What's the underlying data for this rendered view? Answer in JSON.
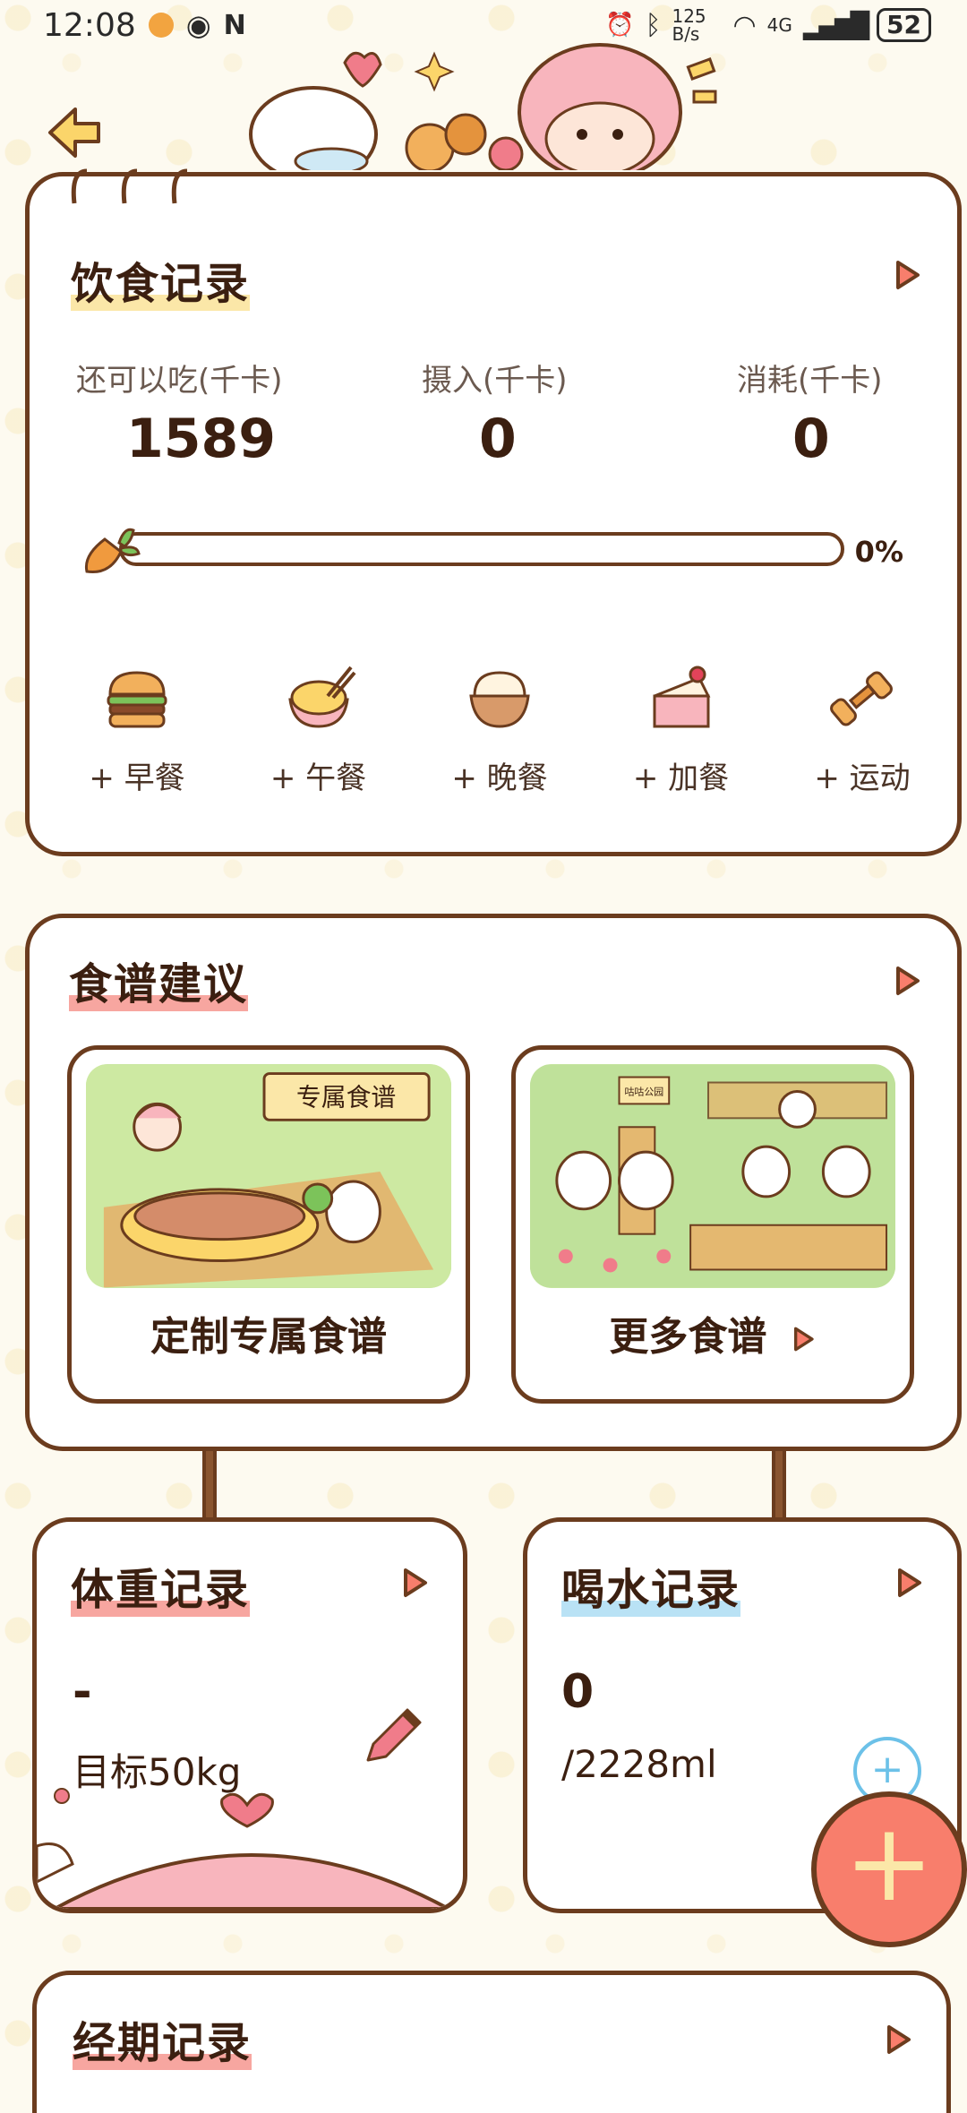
{
  "status_bar": {
    "time": "12:08",
    "net_speed": "125 B/s",
    "network": "4G",
    "battery": "52"
  },
  "diet": {
    "title": "饮食记录",
    "remaining_label": "还可以吃(千卡)",
    "remaining_value": "1589",
    "intake_label": "摄入(千卡)",
    "intake_value": "0",
    "burn_label": "消耗(千卡)",
    "burn_value": "0",
    "progress_pct": "0%",
    "progress_fraction": 0,
    "meals": [
      {
        "label": "+ 早餐",
        "icon": "burger-icon"
      },
      {
        "label": "+ 午餐",
        "icon": "noodle-bowl-icon"
      },
      {
        "label": "+ 晚餐",
        "icon": "rice-bowl-icon"
      },
      {
        "label": "+ 加餐",
        "icon": "cake-icon"
      },
      {
        "label": "+ 运动",
        "icon": "dumbbell-icon"
      }
    ]
  },
  "recipes": {
    "title": "食谱建议",
    "custom_label": "定制专属食谱",
    "custom_sign": "专属食谱",
    "more_label": "更多食谱",
    "more_sign": "咕咕公园"
  },
  "weight": {
    "title": "体重记录",
    "value": "-",
    "target": "目标50kg"
  },
  "water": {
    "title": "喝水记录",
    "value": "0",
    "target": "/2228ml",
    "add": "+"
  },
  "period": {
    "title": "经期记录"
  },
  "fab": {
    "label": "+"
  },
  "colors": {
    "border": "#6b3c1e",
    "accent_red": "#f87e6c",
    "accent_blue": "#6cc1e8",
    "accent_yellow": "#fbe7a8"
  }
}
